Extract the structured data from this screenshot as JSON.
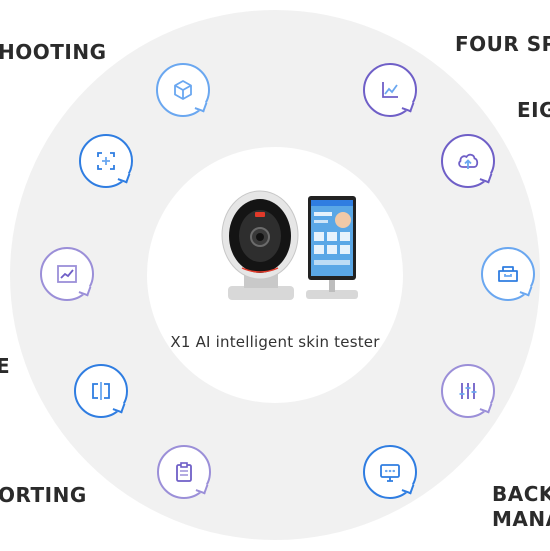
{
  "side_labels": {
    "top_left": "HOOTING",
    "top_right": "FOUR  SP",
    "right_upper": "EIG",
    "left_middle": "E",
    "bottom_left": "ORTING",
    "bottom_right_1": "BACK",
    "bottom_right_2": "MANA"
  },
  "product": {
    "caption": "X1  AI intelligent skin tester"
  },
  "colors": {
    "ring": "#f1f1f1",
    "light_blue": "#6aa7f0",
    "blue": "#2f7de1",
    "purple": "#6f5fc7",
    "light_purple": "#9b8fd8"
  },
  "features": [
    {
      "icon": "cube-icon"
    },
    {
      "icon": "chart-icon"
    },
    {
      "icon": "scan-focus-icon"
    },
    {
      "icon": "cloud-upload-icon"
    },
    {
      "icon": "trend-line-icon"
    },
    {
      "icon": "inbox-icon"
    },
    {
      "icon": "split-compare-icon"
    },
    {
      "icon": "sliders-icon"
    },
    {
      "icon": "clipboard-icon"
    },
    {
      "icon": "monitor-message-icon"
    }
  ]
}
